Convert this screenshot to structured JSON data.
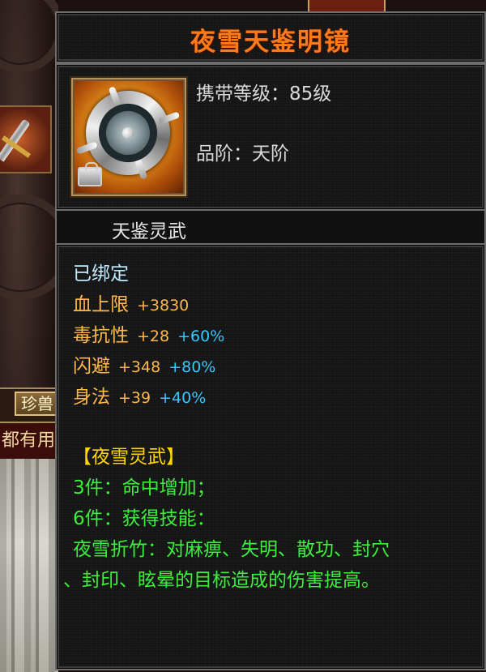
{
  "background": {
    "tab_label": "珍兽",
    "banner_text": "都有用"
  },
  "tooltip": {
    "item_name": "夜雪天鉴明镜",
    "item_icon": "mirror-icon",
    "level_req": "携带等级：85级",
    "grade": "品阶：天阶",
    "category": "天鉴灵武",
    "bound": "已绑定",
    "attributes": [
      {
        "name": "血上限",
        "value": "+3830",
        "percent": ""
      },
      {
        "name": "毒抗性",
        "value": "+28",
        "percent": "+60%"
      },
      {
        "name": "闪避",
        "value": "+348",
        "percent": "+80%"
      },
      {
        "name": "身法",
        "value": "+39",
        "percent": "+40%"
      }
    ],
    "set_title": "【夜雪灵武】",
    "set_bonus_3": "3件：命中增加；",
    "set_bonus_6": "6件：获得技能：",
    "skill_line_1": "夜雪折竹：对麻痹、失明、散功、封穴",
    "skill_line_2": "、封印、眩晕的目标造成的伤害提高。"
  },
  "colors": {
    "title": "#ff7a1a",
    "attribute": "#ffb84a",
    "percent": "#36c8ff",
    "set_title": "#ffd700",
    "set_text": "#3cf03c",
    "bound": "#bfeaff"
  }
}
